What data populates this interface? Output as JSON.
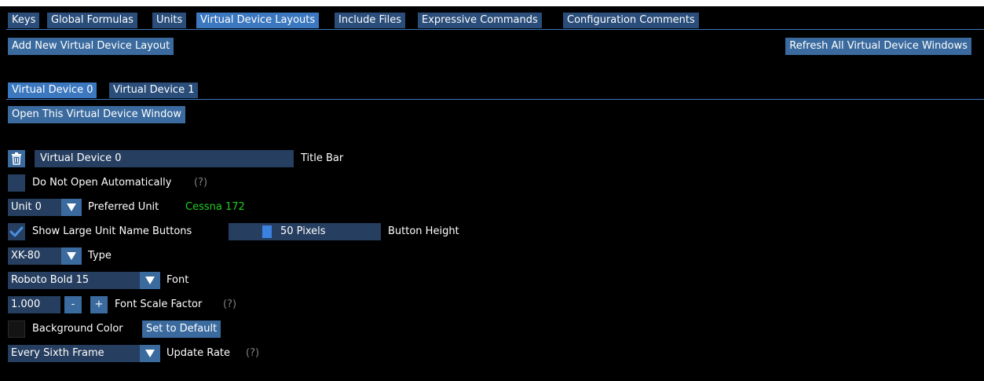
{
  "top_tabs": [
    {
      "label": "Keys",
      "active": false
    },
    {
      "label": "Global Formulas",
      "active": false
    },
    {
      "label": "Units",
      "active": false
    },
    {
      "label": "Virtual Device Layouts",
      "active": true
    },
    {
      "label": "Include Files",
      "active": false
    },
    {
      "label": "Expressive Commands",
      "active": false
    },
    {
      "label": "Configuration Comments",
      "active": false
    }
  ],
  "toolbar": {
    "add_label": "Add New Virtual Device Layout",
    "refresh_label": "Refresh All Virtual Device Windows"
  },
  "device_tabs": [
    {
      "label": "Virtual Device 0",
      "active": true
    },
    {
      "label": "Virtual Device 1",
      "active": false
    }
  ],
  "open_window_label": "Open This Virtual Device Window",
  "form": {
    "title_value": "Virtual Device 0",
    "title_label": "Title Bar",
    "no_open_label": "Do Not Open Automatically",
    "help_marker": "(?)",
    "unit_value": "Unit 0",
    "unit_label": "Preferred Unit",
    "unit_name": "Cessna 172",
    "show_large_label": "Show Large Unit Name Buttons",
    "show_large_checked": true,
    "button_height_value": "50 Pixels",
    "button_height_label": "Button Height",
    "type_value": "XK-80",
    "type_label": "Type",
    "font_value": "Roboto Bold 15",
    "font_label": "Font",
    "scale_value": "1.000",
    "minus_label": "-",
    "plus_label": "+",
    "scale_label": "Font Scale Factor",
    "bg_label": "Background Color",
    "set_default_label": "Set to Default",
    "rate_value": "Every Sixth Frame",
    "rate_label": "Update Rate"
  },
  "colors": {
    "background": "#000000",
    "tab_inactive": "#2a4d7a",
    "tab_active": "#3b78c0",
    "button": "#3a6a9e",
    "field": "#263e5f",
    "unit_name": "#22cc22",
    "help": "#828282"
  },
  "icons": {
    "delete": "trash-icon",
    "check": "check-icon",
    "combo": "triangle-down-icon"
  }
}
